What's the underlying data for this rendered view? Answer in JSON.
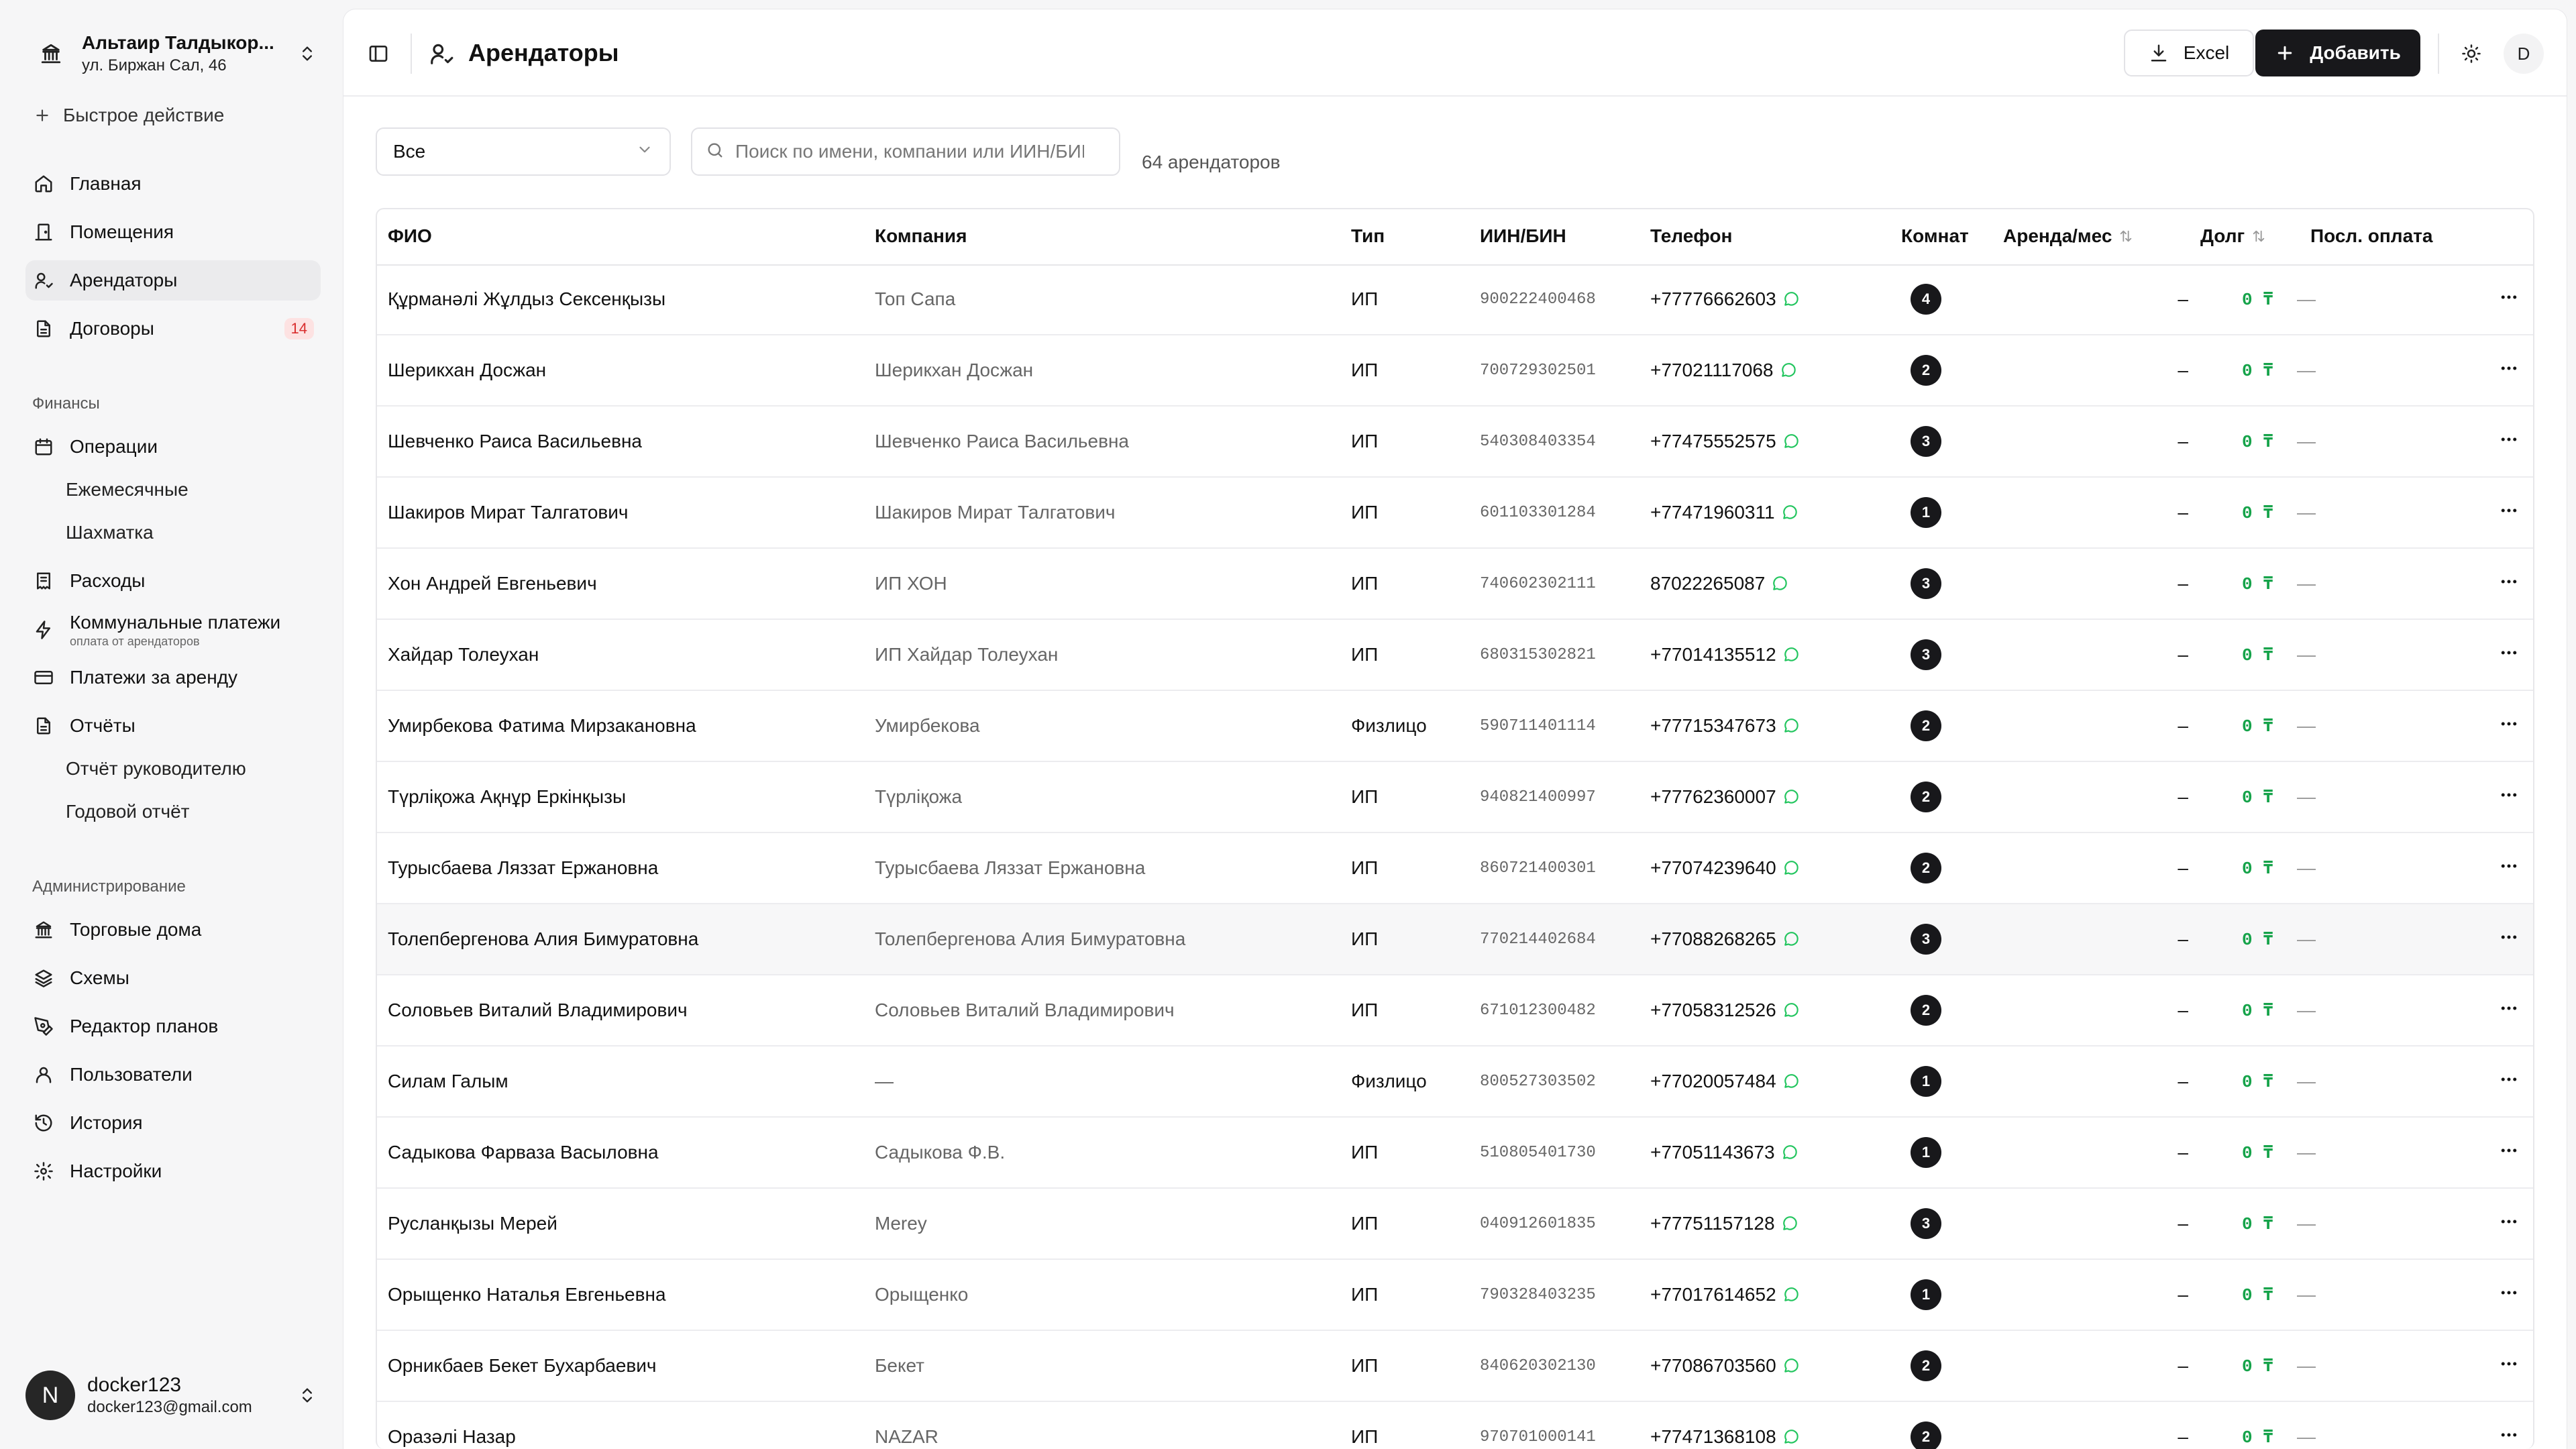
{
  "sidebar": {
    "org_name": "Альтаир Талдыкор...",
    "org_address": "ул. Биржан Сал, 46",
    "quick_action": "Быстрое действие",
    "nav": {
      "home": "Главная",
      "premises": "Помещения",
      "tenants": "Арендаторы",
      "contracts": "Договоры",
      "contracts_badge": "14"
    },
    "finance_section": "Финансы",
    "finance": {
      "operations": "Операции",
      "monthly": "Ежемесячные",
      "chess": "Шахматка",
      "expenses": "Расходы",
      "utilities": "Коммунальные платежи",
      "utilities_hint": "оплата от арендаторов",
      "rent_payments": "Платежи за аренду",
      "reports": "Отчёты",
      "manager_report": "Отчёт руководителю",
      "annual_report": "Годовой отчёт"
    },
    "admin_section": "Администрирование",
    "admin": {
      "malls": "Торговые дома",
      "schemes": "Схемы",
      "plan_editor": "Редактор планов",
      "users": "Пользователи",
      "history": "История",
      "settings": "Настройки"
    },
    "user": {
      "avatar_letter": "N",
      "name": "docker123",
      "email": "docker123@gmail.com"
    }
  },
  "header": {
    "title": "Арендаторы",
    "excel_label": "Excel",
    "add_label": "Добавить",
    "user_initial": "D"
  },
  "filters": {
    "type_value": "Все",
    "search_placeholder": "Поиск по имени, компании или ИИН/БИН",
    "count_text": "64 арендаторов"
  },
  "table": {
    "columns": {
      "name": "ФИО",
      "company": "Компания",
      "type": "Тип",
      "iin": "ИИН/БИН",
      "phone": "Телефон",
      "rooms": "Комнат",
      "rent": "Аренда/мес",
      "debt": "Долг",
      "last_payment": "Посл. оплата"
    },
    "rows": [
      {
        "name": "Құрманәлі Жұлдыз Сексенқызы",
        "company": "Топ Сапа",
        "type": "ИП",
        "iin": "900222400468",
        "phone": "+77776662603",
        "rooms": "4",
        "rent": "–",
        "debt": "0 ₸",
        "last": "—"
      },
      {
        "name": "Шерикхан Досжан",
        "company": "Шерикхан Досжан",
        "type": "ИП",
        "iin": "700729302501",
        "phone": "+77021117068",
        "rooms": "2",
        "rent": "–",
        "debt": "0 ₸",
        "last": "—"
      },
      {
        "name": "Шевченко Раиса Васильевна",
        "company": "Шевченко Раиса Васильевна",
        "type": "ИП",
        "iin": "540308403354",
        "phone": "+77475552575",
        "rooms": "3",
        "rent": "–",
        "debt": "0 ₸",
        "last": "—"
      },
      {
        "name": "Шакиров Мират Талгатович",
        "company": "Шакиров Мират Талгатович",
        "type": "ИП",
        "iin": "601103301284",
        "phone": "+77471960311",
        "rooms": "1",
        "rent": "–",
        "debt": "0 ₸",
        "last": "—"
      },
      {
        "name": "Хон Андрей Евгеньевич",
        "company": "ИП ХОН",
        "type": "ИП",
        "iin": "740602302111",
        "phone": "87022265087",
        "rooms": "3",
        "rent": "–",
        "debt": "0 ₸",
        "last": "—"
      },
      {
        "name": "Хайдар Толеухан",
        "company": "ИП Хайдар Толеухан",
        "type": "ИП",
        "iin": "680315302821",
        "phone": "+77014135512",
        "rooms": "3",
        "rent": "–",
        "debt": "0 ₸",
        "last": "—"
      },
      {
        "name": "Умирбекова Фатима Мирзакановна",
        "company": "Умирбекова",
        "type": "Физлицо",
        "iin": "590711401114",
        "phone": "+77715347673",
        "rooms": "2",
        "rent": "–",
        "debt": "0 ₸",
        "last": "—"
      },
      {
        "name": "Түрліқожа Ақнұр Еркінқызы",
        "company": "Түрліқожа",
        "type": "ИП",
        "iin": "940821400997",
        "phone": "+77762360007",
        "rooms": "2",
        "rent": "–",
        "debt": "0 ₸",
        "last": "—"
      },
      {
        "name": "Турысбаева Ляззат Ержановна",
        "company": "Турысбаева Ляззат Ержановна",
        "type": "ИП",
        "iin": "860721400301",
        "phone": "+77074239640",
        "rooms": "2",
        "rent": "–",
        "debt": "0 ₸",
        "last": "—"
      },
      {
        "name": "Толепбергенова Алия Бимуратовна",
        "company": "Толепбергенова Алия Бимуратовна",
        "type": "ИП",
        "iin": "770214402684",
        "phone": "+77088268265",
        "rooms": "3",
        "rent": "–",
        "debt": "0 ₸",
        "last": "—"
      },
      {
        "name": "Соловьев Виталий Владимирович",
        "company": "Соловьев Виталий Владимирович",
        "type": "ИП",
        "iin": "671012300482",
        "phone": "+77058312526",
        "rooms": "2",
        "rent": "–",
        "debt": "0 ₸",
        "last": "—"
      },
      {
        "name": "Силам Галым",
        "company": "—",
        "type": "Физлицо",
        "iin": "800527303502",
        "phone": "+77020057484",
        "rooms": "1",
        "rent": "–",
        "debt": "0 ₸",
        "last": "—"
      },
      {
        "name": "Садыкова Фарваза Васыловна",
        "company": "Садыкова Ф.В.",
        "type": "ИП",
        "iin": "510805401730",
        "phone": "+77051143673",
        "rooms": "1",
        "rent": "–",
        "debt": "0 ₸",
        "last": "—"
      },
      {
        "name": "Русланқызы Мерей",
        "company": "Merey",
        "type": "ИП",
        "iin": "040912601835",
        "phone": "+77751157128",
        "rooms": "3",
        "rent": "–",
        "debt": "0 ₸",
        "last": "—"
      },
      {
        "name": "Орыщенко Наталья Евгеньевна",
        "company": "Орыщенко",
        "type": "ИП",
        "iin": "790328403235",
        "phone": "+77017614652",
        "rooms": "1",
        "rent": "–",
        "debt": "0 ₸",
        "last": "—"
      },
      {
        "name": "Орникбаев Бекет Бухарбаевич",
        "company": "Бекет",
        "type": "ИП",
        "iin": "840620302130",
        "phone": "+77086703560",
        "rooms": "2",
        "rent": "–",
        "debt": "0 ₸",
        "last": "—"
      },
      {
        "name": "Оразәлі Назар",
        "company": "NAZAR",
        "type": "ИП",
        "iin": "970701000141",
        "phone": "+77471368108",
        "rooms": "2",
        "rent": "–",
        "debt": "0 ₸",
        "last": "—"
      }
    ]
  },
  "colors": {
    "accent": "#18181b",
    "debt_zero": "#16a34a",
    "badge_red": "#d92d2d",
    "whatsapp": "#22c55e"
  }
}
